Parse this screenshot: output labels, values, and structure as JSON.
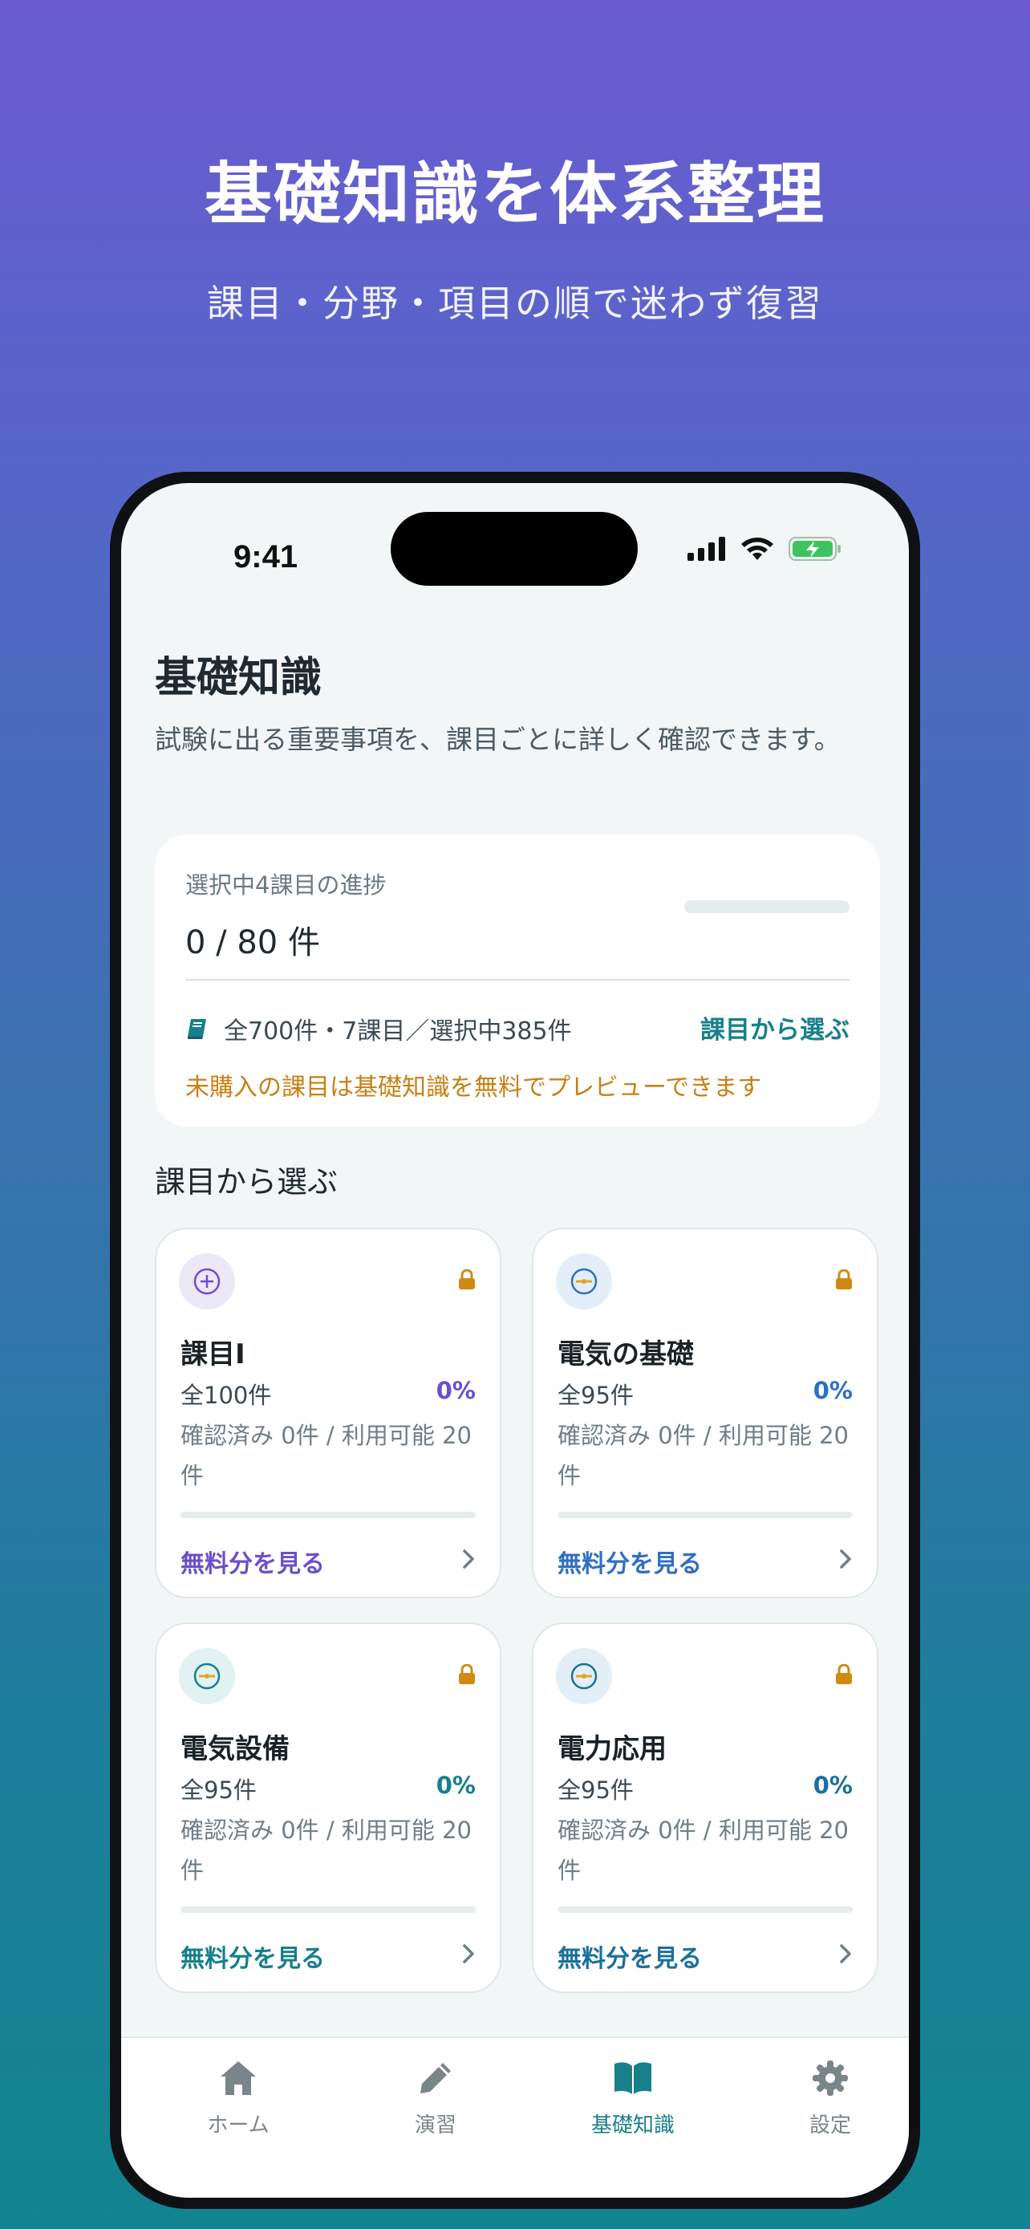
{
  "hero": {
    "title": "基礎知識を体系整理",
    "subtitle": "課目・分野・項目の順で迷わず復習"
  },
  "status_bar": {
    "time": "9:41"
  },
  "page": {
    "title": "基礎知識",
    "description": "試験に出る重要事項を、課目ごとに詳しく確認できます。"
  },
  "progress": {
    "label": "選択中4課目の進捗",
    "count": "0 / 80 件",
    "fraction": 0,
    "info": "全700件・7課目／選択中385件",
    "link": "課目から選ぶ",
    "note": "未購入の課目は基礎知識を無料でプレビューできます"
  },
  "section_title": "課目から選ぶ",
  "subjects": [
    {
      "name": "課目I",
      "total": "全100件",
      "percent": "0%",
      "meta": "確認済み 0件 / 利用可能 20件",
      "link": "無料分を見る",
      "accent": "#6a4fc9",
      "icon_bg": "#ece8f8",
      "icon": "plus-circle-icon"
    },
    {
      "name": "電気の基礎",
      "total": "全95件",
      "percent": "0%",
      "meta": "確認済み 0件 / 利用可能 20件",
      "link": "無料分を見る",
      "accent": "#2f6fc1",
      "icon_bg": "#e4eef9",
      "icon": "bolt-circle-icon"
    },
    {
      "name": "電気設備",
      "total": "全95件",
      "percent": "0%",
      "meta": "確認済み 0件 / 利用可能 20件",
      "link": "無料分を見る",
      "accent": "#167f8c",
      "icon_bg": "#e2f1f2",
      "icon": "bolt-circle-icon"
    },
    {
      "name": "電力応用",
      "total": "全95件",
      "percent": "0%",
      "meta": "確認済み 0件 / 利用可能 20件",
      "link": "無料分を見る",
      "accent": "#1b6f9c",
      "icon_bg": "#e3eff6",
      "icon": "bolt-circle-icon"
    }
  ],
  "tabs": [
    {
      "label": "ホーム",
      "icon": "home-icon",
      "active": false
    },
    {
      "label": "演習",
      "icon": "pencil-icon",
      "active": false
    },
    {
      "label": "基礎知識",
      "icon": "book-icon",
      "active": true
    },
    {
      "label": "設定",
      "icon": "gear-icon",
      "active": false
    }
  ],
  "colors": {
    "accent": "#17808a",
    "warning": "#c98012",
    "lock": "#d08a12",
    "tab_inactive": "#7a8589"
  }
}
